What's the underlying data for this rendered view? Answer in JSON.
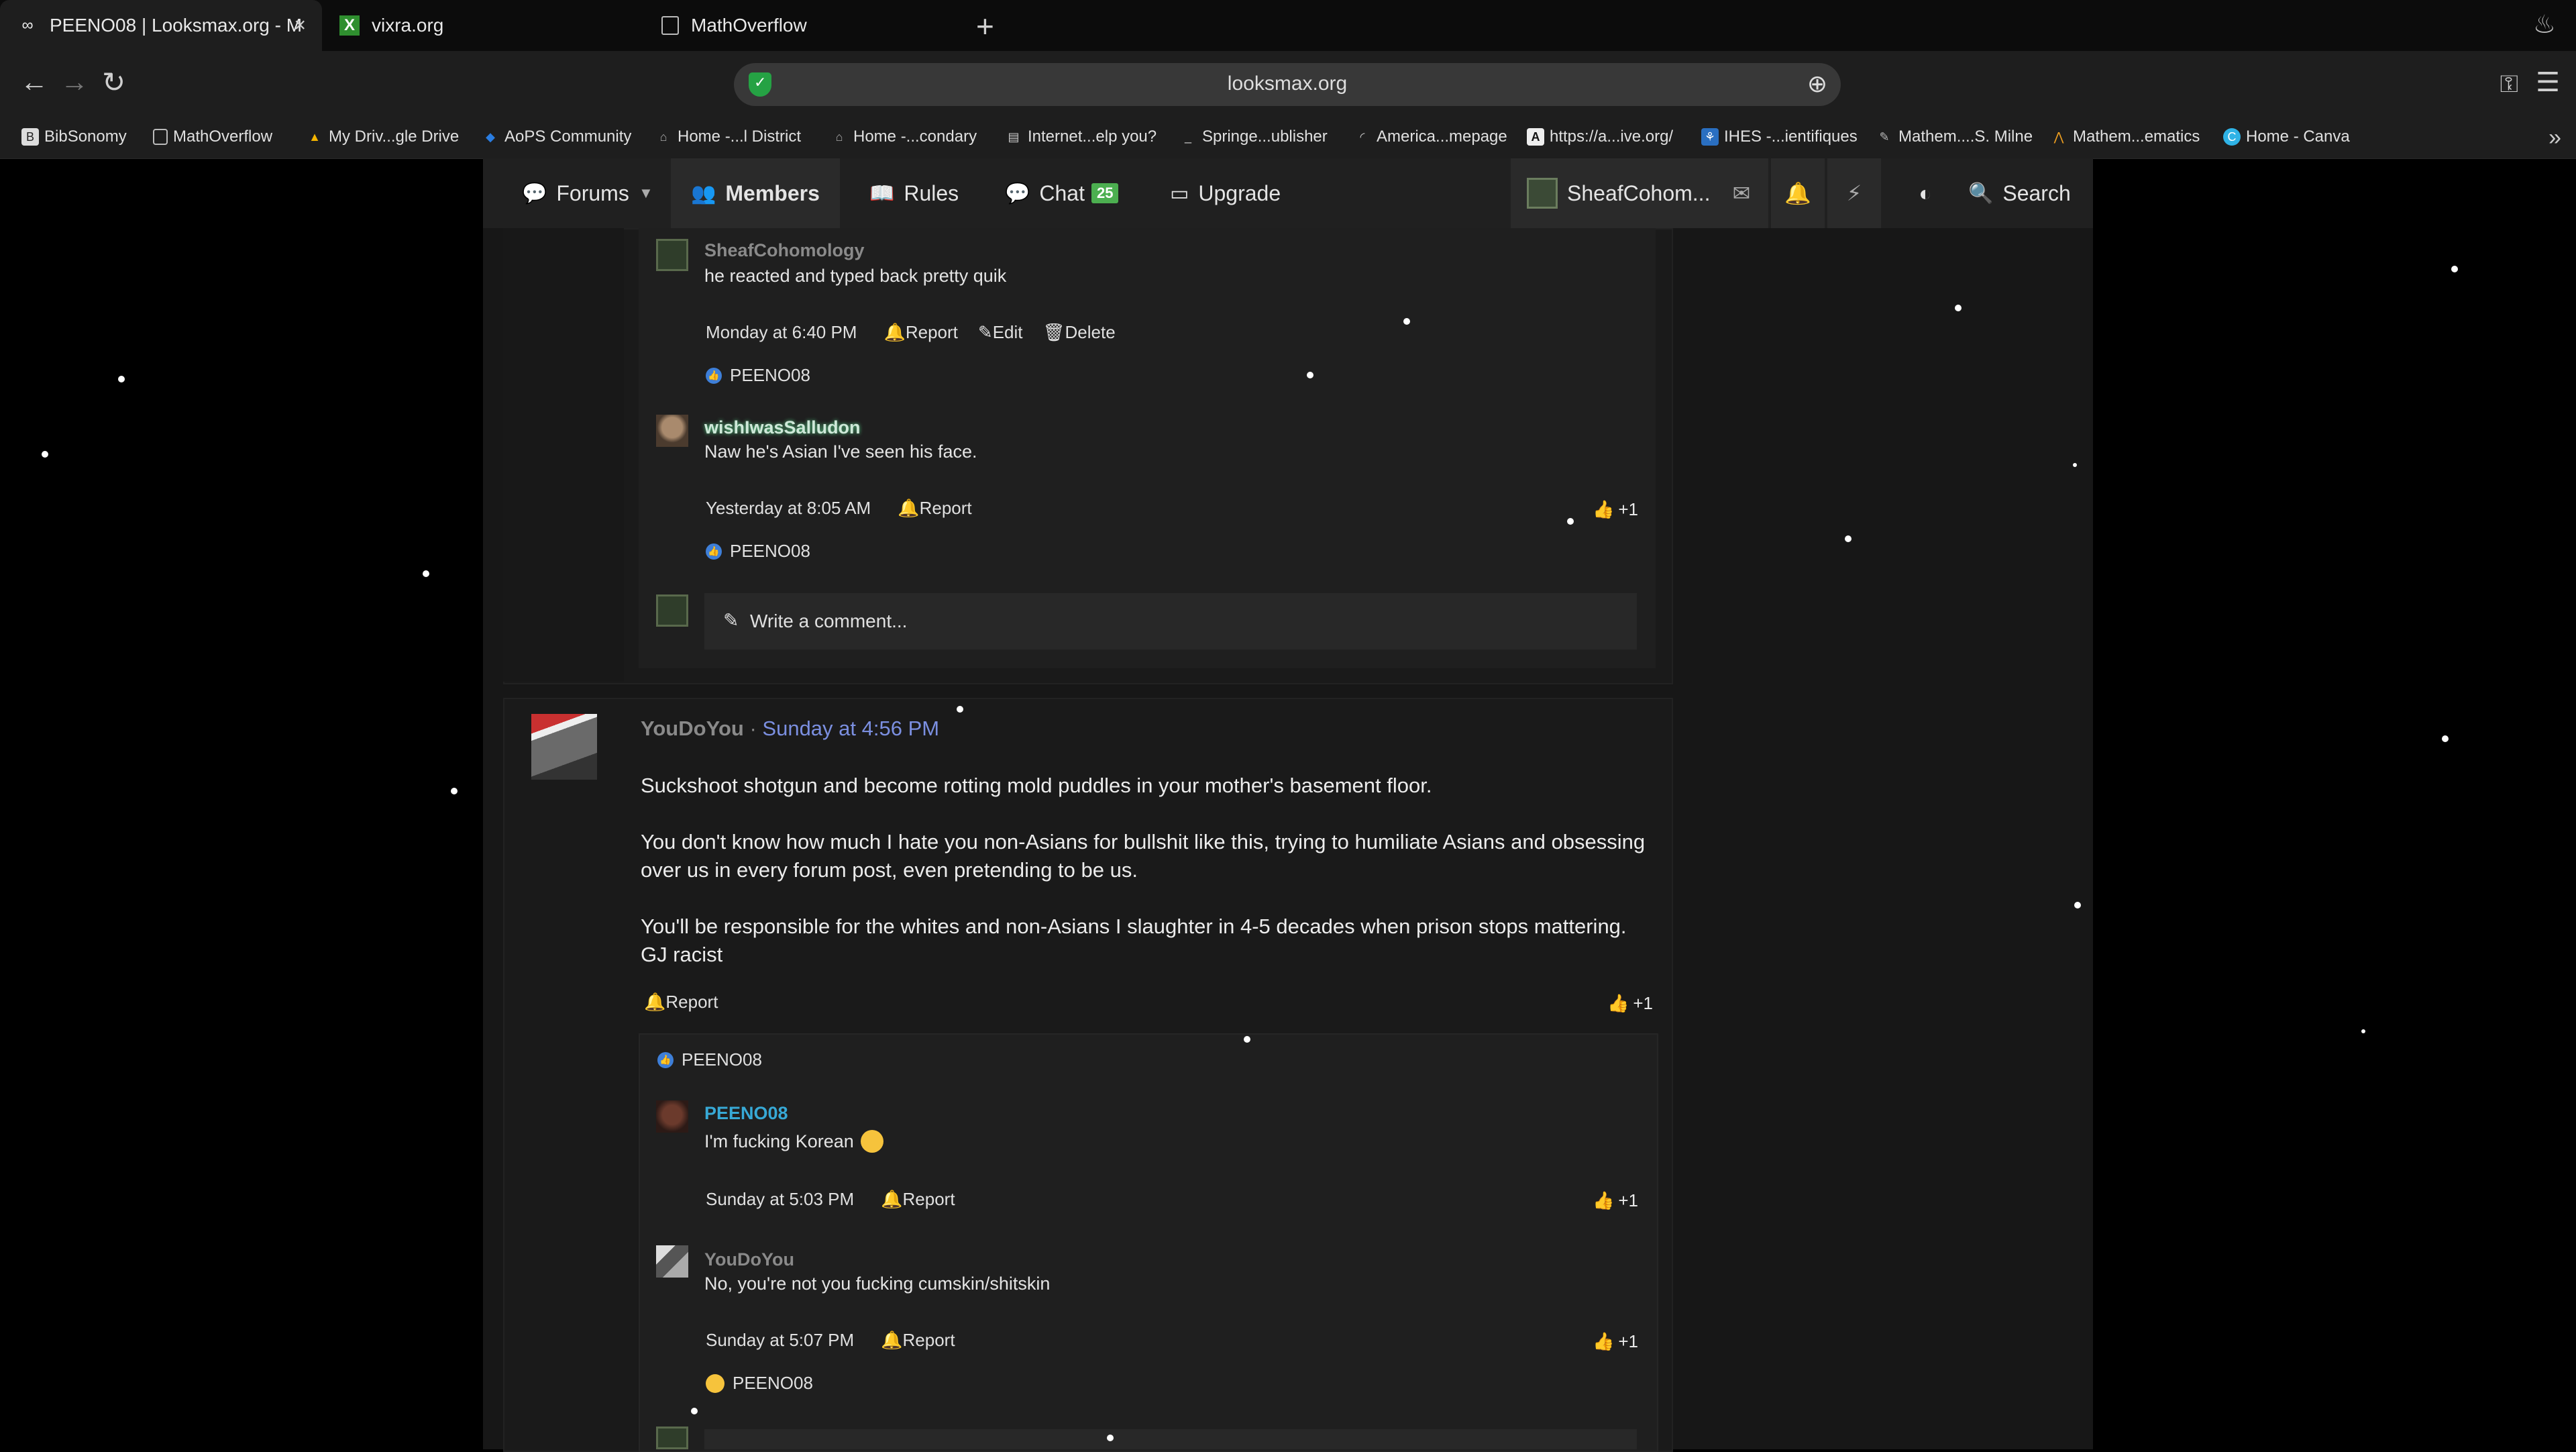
{
  "browser": {
    "tabs": [
      {
        "title": "PEENO08 | Looksmax.org - M",
        "active": true
      },
      {
        "title": "vixra.org",
        "active": false
      },
      {
        "title": "MathOverflow",
        "active": false
      }
    ],
    "url": "looksmax.org",
    "bookmarks": [
      "BibSonomy",
      "MathOverflow",
      "My Driv...gle Drive",
      "AoPS Community",
      "Home -...l District",
      "Home -...condary",
      "Internet...elp you?",
      "Springe...ublisher",
      "America...mepage",
      "https://a...ive.org/",
      "IHES -...ientifiques",
      "Mathem....S. Milne",
      "Mathem...ematics",
      "Home - Canva"
    ]
  },
  "site_nav": {
    "forums": "Forums",
    "members": "Members",
    "rules": "Rules",
    "chat": "Chat",
    "chat_count": "25",
    "upgrade": "Upgrade",
    "user": "SheafCohom...",
    "search": "Search"
  },
  "thread1": {
    "comments": [
      {
        "author": "SheafCohomology",
        "text": "he reacted and typed back pretty quik",
        "time": "Monday at 6:40 PM",
        "actions": [
          "Report",
          "Edit",
          "Delete"
        ],
        "reaction_user": "PEENO08"
      },
      {
        "author": "wishIwasSalludon",
        "text": "Naw he's Asian I've seen his face.",
        "time": "Yesterday at 8:05 AM",
        "actions": [
          "Report"
        ],
        "plus": "+1",
        "reaction_user": "PEENO08"
      }
    ],
    "write_placeholder": "Write a comment..."
  },
  "post2": {
    "author": "YouDoYou",
    "dot": "·",
    "time": "Sunday at 4:56 PM",
    "paragraphs": [
      "Suckshoot shotgun and become rotting mold puddles in your mother's basement floor.",
      "You don't know how much I hate you non-Asians for bullshit like this, trying to humiliate Asians and obsessing over us in every forum post, even pretending to be us.",
      "You'll be responsible for the whites and non-Asians I slaughter in 4-5 decades when prison stops mattering. GJ racist"
    ],
    "report": "Report",
    "plus": "+1",
    "reaction_user": "PEENO08",
    "comments": [
      {
        "author": "PEENO08",
        "text": "I'm fucking Korean",
        "time": "Sunday at 5:03 PM",
        "action": "Report",
        "plus": "+1"
      },
      {
        "author": "YouDoYou",
        "text": "No, you're not you fucking cumskin/shitskin",
        "time": "Sunday at 5:07 PM",
        "action": "Report",
        "plus": "+1",
        "reaction_user": "PEENO08"
      }
    ]
  },
  "colors": {
    "background": "#000000",
    "panel": "#1a1a1a",
    "link_blue": "#7b8fe0",
    "username_cyan": "#37a9d6",
    "chat_badge": "#4caf50",
    "shield_green": "#25a244"
  }
}
